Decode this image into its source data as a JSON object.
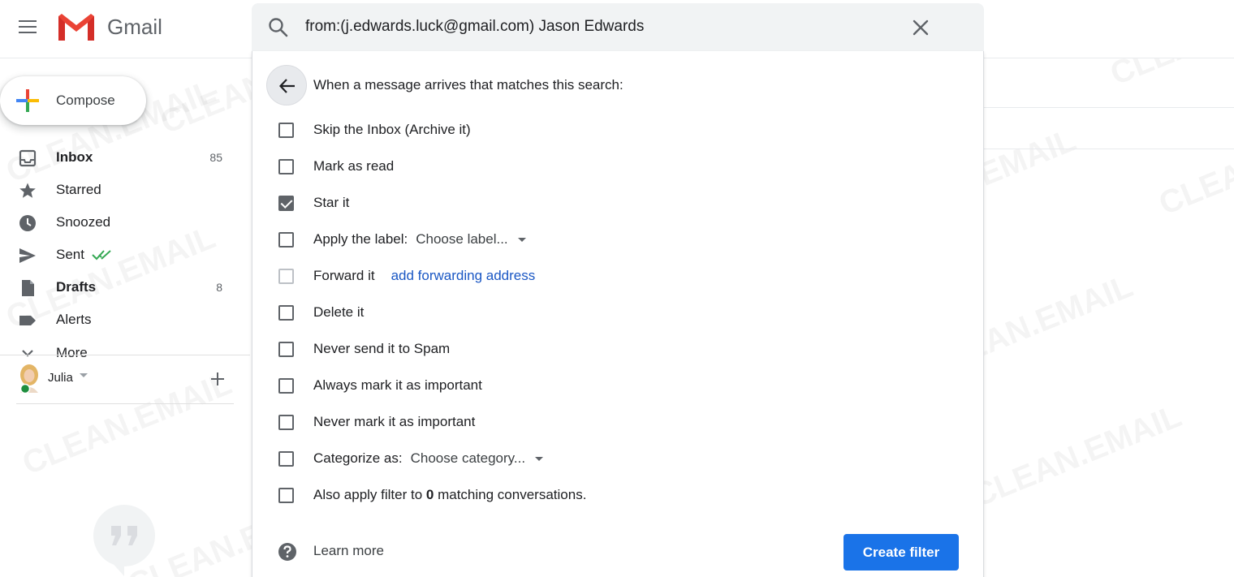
{
  "header": {
    "app_name": "Gmail",
    "search_value": "from:(j.edwards.luck@gmail.com) Jason Edwards"
  },
  "sidebar": {
    "compose_label": "Compose",
    "items": [
      {
        "label": "Inbox",
        "count": "85",
        "icon": "inbox-icon"
      },
      {
        "label": "Starred",
        "count": "",
        "icon": "star-icon"
      },
      {
        "label": "Snoozed",
        "count": "",
        "icon": "clock-icon"
      },
      {
        "label": "Sent",
        "count": "",
        "icon": "send-icon"
      },
      {
        "label": "Drafts",
        "count": "8",
        "icon": "draft-icon"
      },
      {
        "label": "Alerts",
        "count": "",
        "icon": "label-icon"
      },
      {
        "label": "More",
        "count": "",
        "icon": "chevron-down-icon"
      }
    ],
    "user_name": "Julia"
  },
  "filter": {
    "heading": "When a message arrives that matches this search:",
    "options": [
      {
        "label": "Skip the Inbox (Archive it)",
        "checked": false
      },
      {
        "label": "Mark as read",
        "checked": false
      },
      {
        "label": "Star it",
        "checked": true
      },
      {
        "label": "Apply the label:",
        "checked": false,
        "dropdown": "Choose label..."
      },
      {
        "label": "Forward it",
        "checked": false,
        "link": "add forwarding address"
      },
      {
        "label": "Delete it",
        "checked": false
      },
      {
        "label": "Never send it to Spam",
        "checked": false
      },
      {
        "label": "Always mark it as important",
        "checked": false
      },
      {
        "label": "Never mark it as important",
        "checked": false
      },
      {
        "label": "Categorize as:",
        "checked": false,
        "dropdown": "Choose category..."
      },
      {
        "label_prefix": "Also apply filter to ",
        "label_bold": "0",
        "label_suffix": " matching conversations.",
        "checked": false
      }
    ],
    "learn_more": "Learn more",
    "create_button": "Create filter"
  },
  "watermark": "CLEAN.EMAIL",
  "colors": {
    "accent": "#1a73e8",
    "link": "#1a57c4",
    "sent_check": "#34a853"
  }
}
